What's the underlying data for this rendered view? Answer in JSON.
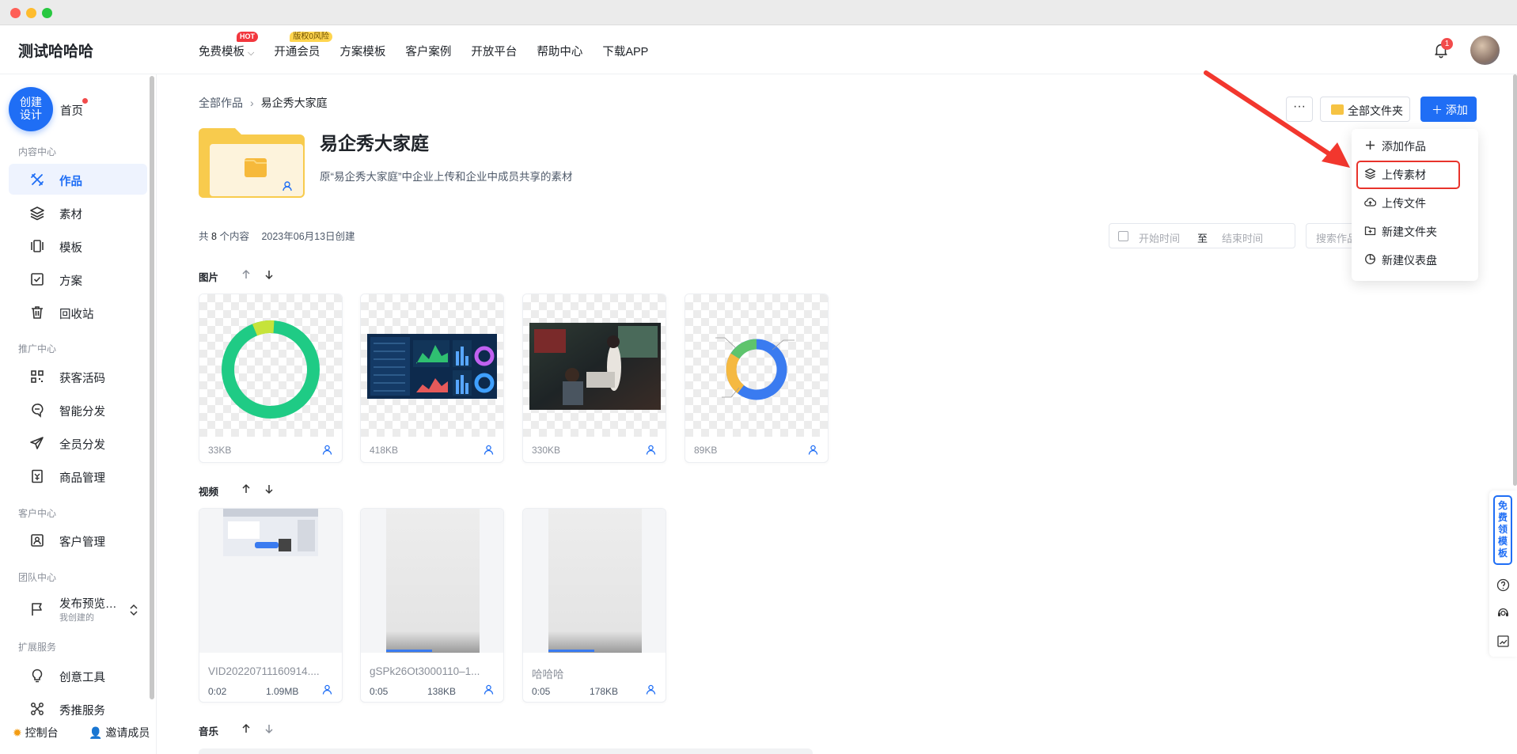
{
  "window": {
    "controls": [
      "close",
      "minimize",
      "maximize"
    ]
  },
  "topnav": {
    "brand": "测试哈哈哈",
    "links": [
      {
        "label": "免费模板",
        "badge": "HOT"
      },
      {
        "label": "开通会员",
        "badge": "版权0风险"
      },
      {
        "label": "方案模板"
      },
      {
        "label": "客户案例"
      },
      {
        "label": "开放平台"
      },
      {
        "label": "帮助中心"
      },
      {
        "label": "下载APP"
      }
    ],
    "bell_count": "1"
  },
  "sidebar": {
    "create_label_1": "创建",
    "create_label_2": "设计",
    "home": "首页",
    "sections": {
      "content": "内容中心",
      "promo": "推广中心",
      "customer": "客户中心",
      "team": "团队中心",
      "ext": "扩展服务"
    },
    "items": {
      "works": "作品",
      "materials": "素材",
      "templates": "模板",
      "plans": "方案",
      "trash": "回收站",
      "leads": "获客活码",
      "smart": "智能分发",
      "staff": "全员分发",
      "goods": "商品管理",
      "crm": "客户管理",
      "publish": "发布预览…",
      "publish_sub": "我创建的",
      "creative": "创意工具",
      "xiutui": "秀推服务"
    },
    "bottom": {
      "console": "控制台",
      "invite": "邀请成员"
    }
  },
  "main": {
    "breadcrumb": {
      "root": "全部作品",
      "current": "易企秀大家庭"
    },
    "folder": {
      "title": "易企秀大家庭",
      "desc": "原“易企秀大家庭”中企业上传和企业中成员共享的素材"
    },
    "meta": {
      "prefix": "共",
      "count": "8",
      "suffix": "个内容",
      "created": "2023年06月13日创建"
    },
    "actions": {
      "more": "···",
      "all_folders": "全部文件夹",
      "add": "添加"
    },
    "filters": {
      "start": "开始时间",
      "to": "至",
      "end": "结束时间",
      "search_placeholder": "搜索作品"
    },
    "sections": {
      "images": "图片",
      "videos": "视频",
      "music": "音乐"
    },
    "images": [
      {
        "size": "33KB",
        "kind": "donut"
      },
      {
        "size": "418KB",
        "kind": "dashboard"
      },
      {
        "size": "330KB",
        "kind": "photo"
      },
      {
        "size": "89KB",
        "kind": "piechart"
      }
    ],
    "videos": [
      {
        "name": "VID20220711160914....",
        "duration": "0:02",
        "size": "1.09MB"
      },
      {
        "name": "gSPk26Ot3000110–1...",
        "duration": "0:05",
        "size": "138KB"
      },
      {
        "name": "哈哈哈",
        "duration": "0:05",
        "size": "178KB"
      }
    ]
  },
  "dropdown": {
    "items": [
      "添加作品",
      "上传素材",
      "上传文件",
      "新建文件夹",
      "新建仪表盘"
    ],
    "highlighted": "上传素材"
  },
  "floatbar": {
    "free_label": "免费领模板"
  },
  "colors": {
    "accent": "#1f6ef5",
    "highlight": "#e8332b",
    "folder": "#f6c343"
  }
}
